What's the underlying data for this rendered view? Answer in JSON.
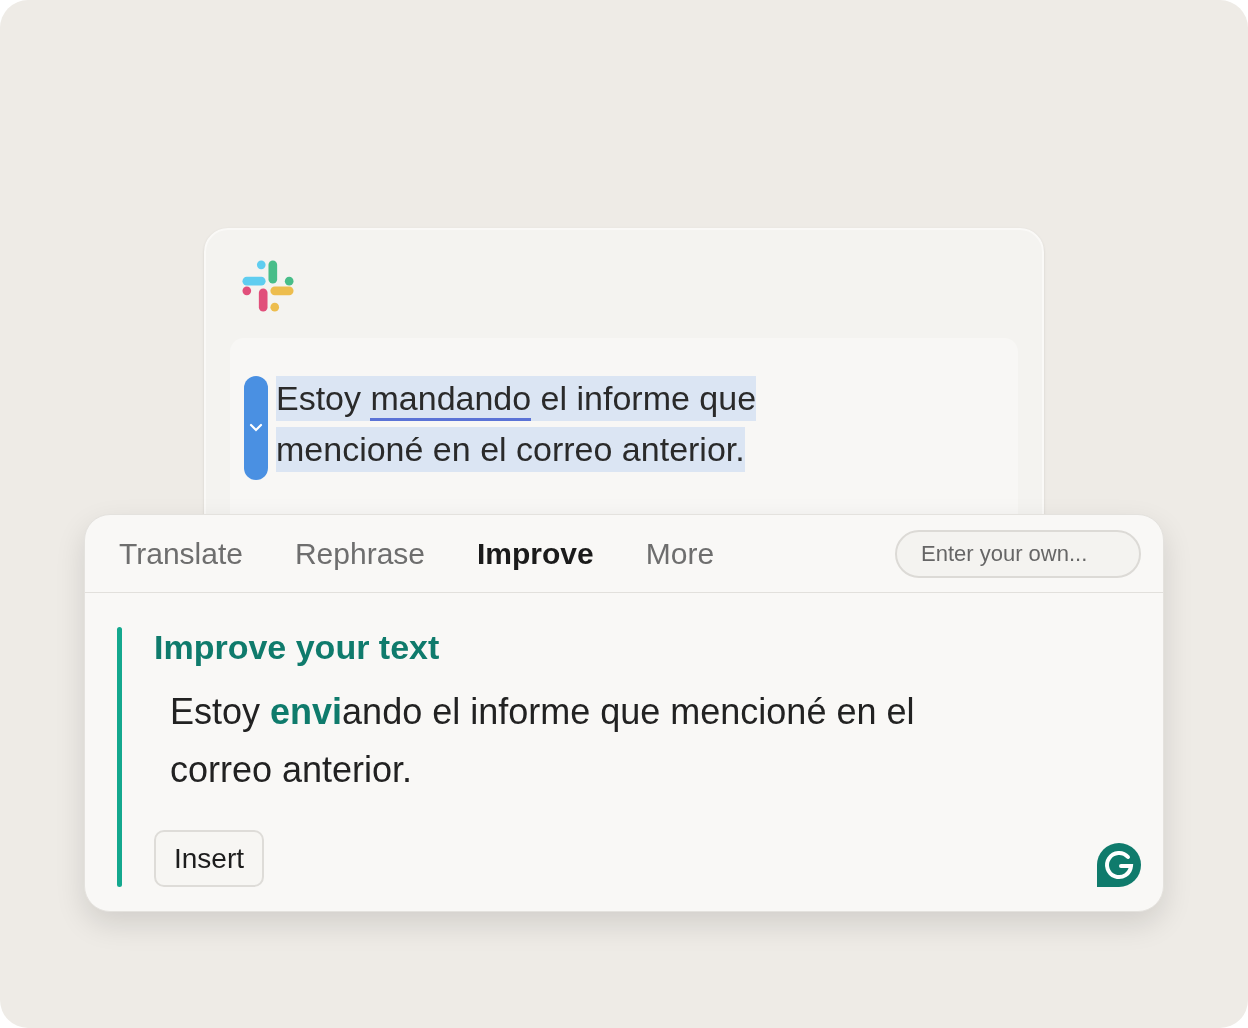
{
  "editor": {
    "lines": [
      [
        {
          "text": "Estoy ",
          "flagged": false
        },
        {
          "text": "mandando",
          "flagged": true
        },
        {
          "text": " el informe que",
          "flagged": false
        }
      ],
      [
        {
          "text": "mencioné en el correo anterior.",
          "flagged": false
        }
      ]
    ]
  },
  "popup": {
    "tabs": [
      {
        "label": "Translate",
        "selected": false
      },
      {
        "label": "Rephrase",
        "selected": false
      },
      {
        "label": "Improve",
        "selected": true
      },
      {
        "label": "More",
        "selected": false
      }
    ],
    "prompt_field": {
      "placeholder": "Enter your own..."
    },
    "title": "Improve your text",
    "suggestion_lines": [
      "Estoy **envi**ando el informe que mencioné en el",
      "correo anterior."
    ],
    "insert_button": "Insert"
  }
}
